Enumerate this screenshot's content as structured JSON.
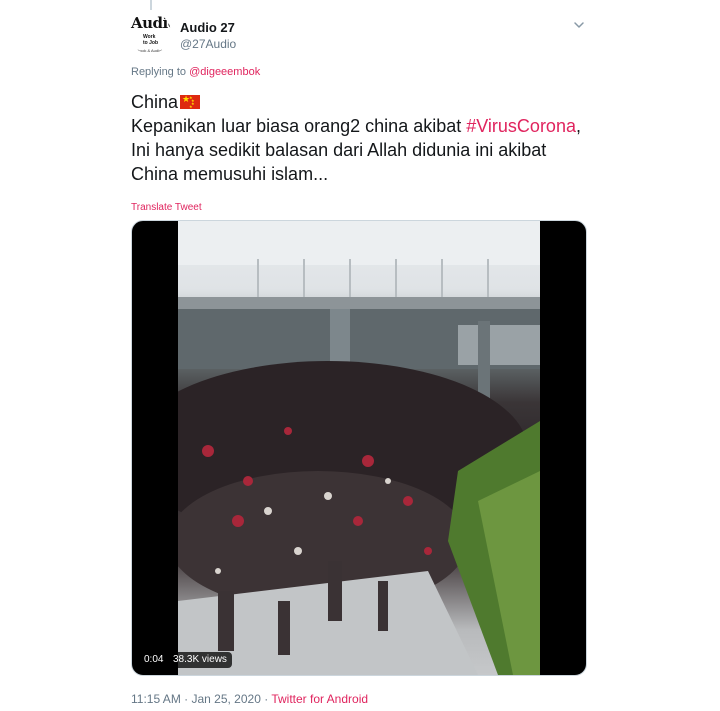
{
  "tweet": {
    "avatar": {
      "word": "Audio",
      "small_line1": "Work",
      "small_line2": "to Job",
      "tiny": "Ebook & Audiobook"
    },
    "display_name": "Audio 27",
    "handle": "@27Audio",
    "replying_prefix": "Replying to ",
    "replying_handle": "@digeeembok",
    "text": {
      "line1": "China",
      "line1_flag": "china-flag-emoji",
      "line2_prefix": "Kepanikan luar biasa orang2 china akibat ",
      "hashtag": "#VirusCorona",
      "line2_suffix": ",",
      "line3": "Ini hanya sedikit balasan dari Allah didunia ini akibat",
      "line4": "China memusuhi islam..."
    },
    "translate_label": "Translate Tweet",
    "media": {
      "type": "video",
      "time": "0:04",
      "views": "38.3K views"
    },
    "timestamp": "11:15 AM · Jan 25, 2020",
    "separator": " · ",
    "source": "Twitter for Android"
  },
  "colors": {
    "accent": "#e0245e",
    "secondary_text": "#657786",
    "primary_text": "#14171a",
    "border": "#ccd6dd"
  },
  "icons": {
    "caret": "chevron-down-icon"
  }
}
